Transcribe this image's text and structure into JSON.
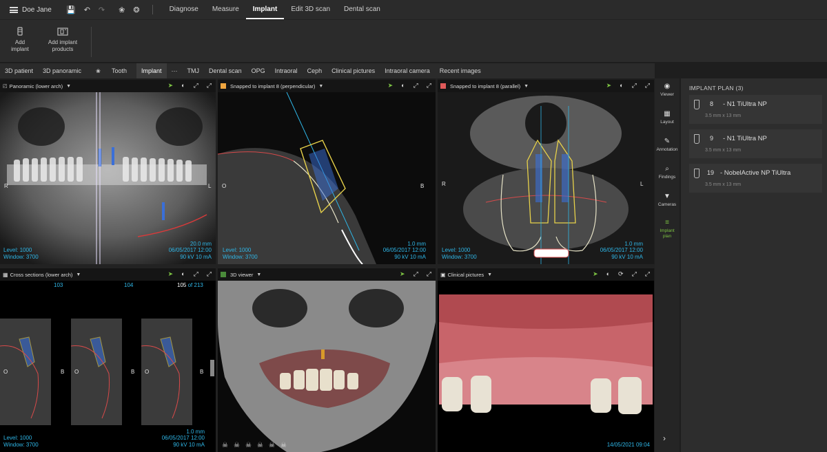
{
  "topbar": {
    "user": "Doe Jane",
    "nav": [
      {
        "label": "Diagnose",
        "active": false
      },
      {
        "label": "Measure",
        "active": false
      },
      {
        "label": "Implant",
        "active": true
      },
      {
        "label": "Edit 3D scan",
        "active": false
      },
      {
        "label": "Dental scan",
        "active": false
      }
    ]
  },
  "ribbon": {
    "add_implant": "Add\nimplant",
    "add_implant_products": "Add implant\nproducts"
  },
  "tabs": [
    {
      "label": "3D patient",
      "active": false
    },
    {
      "label": "3D panoramic",
      "active": false
    },
    {
      "label": "Tooth",
      "active": false
    },
    {
      "label": "Implant",
      "active": true
    },
    {
      "label": "···",
      "active": false
    },
    {
      "label": "TMJ",
      "active": false
    },
    {
      "label": "Dental scan",
      "active": false
    },
    {
      "label": "OPG",
      "active": false
    },
    {
      "label": "Intraoral",
      "active": false
    },
    {
      "label": "Ceph",
      "active": false
    },
    {
      "label": "Clinical pictures",
      "active": false
    },
    {
      "label": "Intraoral camera",
      "active": false
    },
    {
      "label": "Recent images",
      "active": false
    }
  ],
  "viewports": {
    "panoramic": {
      "title": "Panoramic (lower arch)",
      "left_label": "R",
      "right_label": "L",
      "level": "Level: 1000",
      "window": "Window: 3700",
      "thickness": "20.0 mm",
      "date": "06/05/2017 12:00",
      "exposure": "90 kV  10 mA"
    },
    "perpendicular": {
      "title": "Snapped to implant 8 (perpendicular)",
      "color": "#f0a640",
      "left_label": "O",
      "right_label": "B",
      "level": "Level: 1000",
      "window": "Window: 3700",
      "thickness": "1.0 mm",
      "date": "06/05/2017 12:00",
      "exposure": "90 kV  10 mA"
    },
    "parallel": {
      "title": "Snapped to implant 8 (parallel)",
      "color": "#e05a5a",
      "left_label": "R",
      "right_label": "L",
      "level": "Level: 1000",
      "window": "Window: 3700",
      "thickness": "1.0 mm",
      "date": "06/05/2017 12:00",
      "exposure": "90 kV  10 mA"
    },
    "cross": {
      "title": "Cross sections (lower arch)",
      "idx1": "103",
      "idx2": "104",
      "idx3": "105",
      "of_total": "of 213",
      "o_label": "O",
      "b_label": "B",
      "level": "Level: 1000",
      "window": "Window: 3700",
      "thickness": "1.0 mm",
      "date": "06/05/2017 12:00",
      "exposure": "90 kV  10 mA"
    },
    "viewer3d": {
      "title": "3D viewer"
    },
    "clinical": {
      "title": "Clinical pictures",
      "date": "14/05/2021 09:04"
    }
  },
  "sidebar": [
    {
      "label": "Viewer",
      "icon": "eye-icon",
      "active": false
    },
    {
      "label": "Layout",
      "icon": "layout-icon",
      "active": false
    },
    {
      "label": "Annotation",
      "icon": "pencil-icon",
      "active": false
    },
    {
      "label": "Findings",
      "icon": "findings-icon",
      "active": false
    },
    {
      "label": "Cameras",
      "icon": "camera-icon",
      "active": false
    },
    {
      "label": "Implant plan",
      "icon": "implant-icon",
      "active": true
    }
  ],
  "implant_plan": {
    "title": "IMPLANT PLAN (3)",
    "items": [
      {
        "tooth": "8",
        "name": "- N1 TiUltra NP",
        "dims": "3.5 mm x 13 mm"
      },
      {
        "tooth": "9",
        "name": "- N1 TiUltra NP",
        "dims": "3.5 mm x 13 mm"
      },
      {
        "tooth": "19",
        "name": "- NobelActive NP TiUltra",
        "dims": "3.5 mm x 13 mm"
      }
    ]
  },
  "colors": {
    "accent": "#7cc142",
    "info": "#2fb7e8",
    "implant": "#e8d24a"
  }
}
